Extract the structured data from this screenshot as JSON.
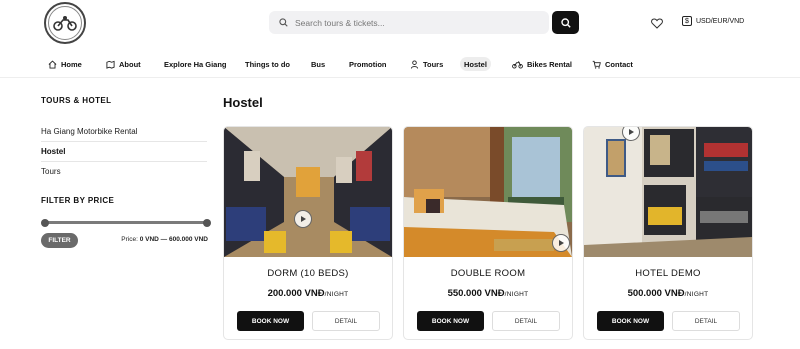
{
  "header": {
    "search_placeholder": "Search tours & tickets...",
    "currency": "USD/EUR/VND"
  },
  "nav": {
    "items": [
      {
        "label": "Home",
        "icon": "home-icon"
      },
      {
        "label": "About",
        "icon": "map-icon"
      },
      {
        "label": "Explore Ha Giang"
      },
      {
        "label": "Things to do"
      },
      {
        "label": "Bus"
      },
      {
        "label": "Promotion"
      },
      {
        "label": "Tours",
        "icon": "person-icon"
      },
      {
        "label": "Hostel",
        "active": true
      },
      {
        "label": "Bikes Rental",
        "icon": "motorbike-icon"
      },
      {
        "label": "Contact",
        "icon": "cart-icon"
      }
    ]
  },
  "sidebar": {
    "title": "TOURS & HOTEL",
    "links": [
      {
        "label": "Ha Giang Motorbike Rental"
      },
      {
        "label": "Hostel",
        "active": true
      },
      {
        "label": "Tours"
      }
    ],
    "filter_title": "FILTER BY PRICE",
    "filter_button": "FILTER",
    "price_prefix": "Price:",
    "price_range": "0 VND — 600.000 VND"
  },
  "main": {
    "title": "Hostel",
    "cards": [
      {
        "name": "DORM (10 BEDS)",
        "price": "200.000 VNĐ",
        "unit": "/NIGHT",
        "book": "BOOK NOW",
        "detail": "DETAIL"
      },
      {
        "name": "DOUBLE ROOM",
        "price": "550.000 VNĐ",
        "unit": "/NIGHT",
        "book": "BOOK NOW",
        "detail": "DETAIL"
      },
      {
        "name": "HOTEL DEMO",
        "price": "500.000 VNĐ",
        "unit": "/NIGHT",
        "book": "BOOK NOW",
        "detail": "DETAIL"
      }
    ]
  }
}
